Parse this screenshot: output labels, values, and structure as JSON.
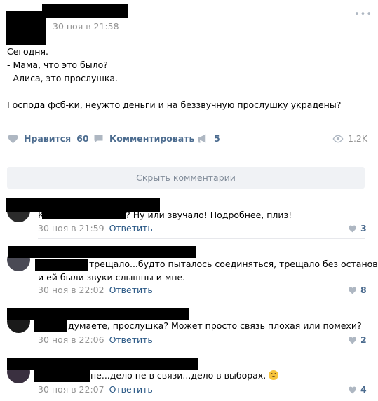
{
  "post": {
    "date": "30 ноя в 21:58",
    "more": "•••",
    "text": [
      "Сегодня.",
      "- Мама, что это было?",
      "- Алиса, это прослушка.",
      "",
      "Господа фсб-ки, неужто деньги и на беззвучную прослушку украдены?"
    ],
    "actions": {
      "like_label": "Нравится",
      "like_count": "60",
      "comment_label": "Комментировать",
      "share_count": "5",
      "views": "1.2K"
    }
  },
  "hide_comments_label": "Скрыть комментарии",
  "comments": [
    {
      "lines": [
        "Как это выглядело? Ну или звучало! Подробнее, плиз!"
      ],
      "date": "30 ноя в 21:59",
      "reply": "Ответить",
      "likes": "3"
    },
    {
      "lines": [
        "трещало...будто пыталось соединяться, трещало без остановки",
        "и ей были звуки слышны и мне."
      ],
      "date": "30 ноя в 22:02",
      "reply": "Ответить",
      "likes": "8"
    },
    {
      "lines": [
        "думаете, прослушка? Может просто связь плохая или помехи?"
      ],
      "date": "30 ноя в 22:06",
      "reply": "Ответить",
      "likes": "2"
    },
    {
      "lines": [
        "не...дело не в связи...дело в выборах."
      ],
      "date": "30 ноя в 22:07",
      "reply": "Ответить",
      "likes": "4"
    }
  ],
  "colors": {
    "link": "#2a5885",
    "meta": "#939393",
    "icon": "#aeb7c2",
    "button_bg": "#f0f2f5"
  }
}
